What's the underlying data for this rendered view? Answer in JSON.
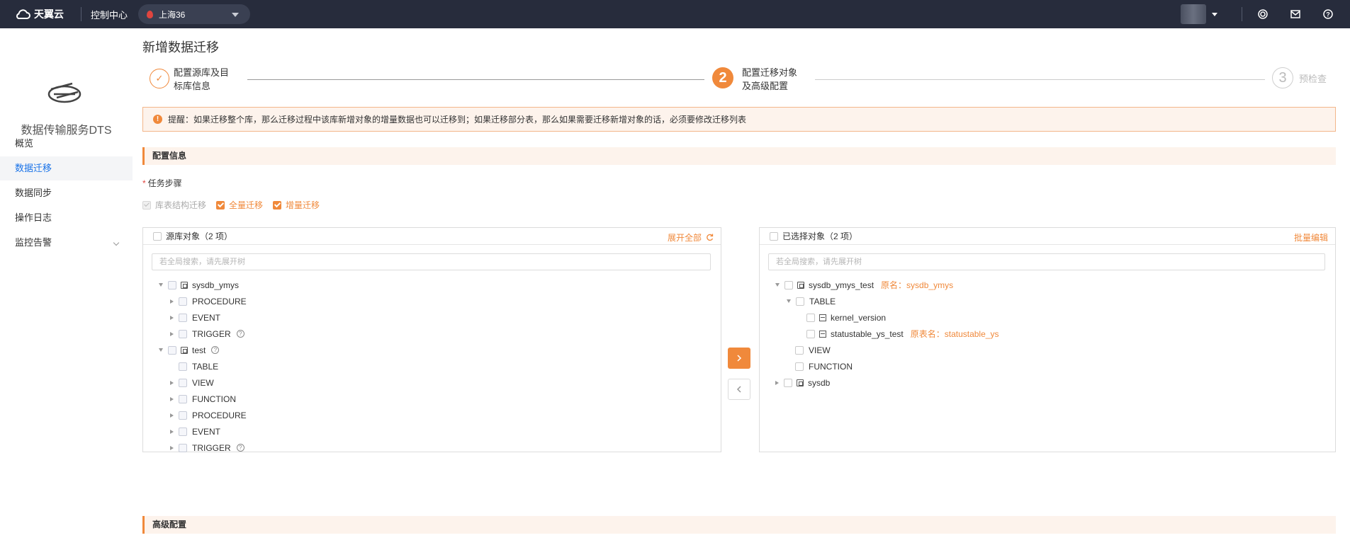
{
  "topbar": {
    "brand": "天翼云",
    "console": "控制中心",
    "region": "上海36",
    "icons": [
      "support-icon",
      "mail-icon",
      "help-icon"
    ]
  },
  "sidebar": {
    "title": "数据传输服务DTS",
    "items": [
      {
        "label": "概览",
        "active": false
      },
      {
        "label": "数据迁移",
        "active": true
      },
      {
        "label": "数据同步",
        "active": false
      },
      {
        "label": "操作日志",
        "active": false
      },
      {
        "label": "监控告警",
        "active": false,
        "expandable": true
      }
    ]
  },
  "main": {
    "title": "新增数据迁移",
    "steps": [
      {
        "label_line1": "配置源库及目",
        "label_line2": "标库信息",
        "state": "done",
        "number": "✓"
      },
      {
        "label_line1": "配置迁移对象",
        "label_line2": "及高级配置",
        "state": "active",
        "number": "2"
      },
      {
        "label_line1": "预检查",
        "label_line2": "",
        "state": "pending",
        "number": "3"
      }
    ],
    "notice": "提醒：如果迁移整个库，那么迁移过程中该库新增对象的增量数据也可以迁移到；如果迁移部分表，那么如果需要迁移新增对象的话，必须要修改迁移列表",
    "config_section": "配置信息",
    "task_steps_label": "任务步骤",
    "task_steps": [
      {
        "label": "库表结构迁移",
        "checked": true,
        "disabled": true
      },
      {
        "label": "全量迁移",
        "checked": true,
        "disabled": false
      },
      {
        "label": "增量迁移",
        "checked": true,
        "disabled": false
      }
    ],
    "advanced_section": "高级配置"
  },
  "source_panel": {
    "title": "源库对象（2 项）",
    "expand_all": "展开全部",
    "search_placeholder": "若全局搜索，请先展开树",
    "tree": [
      {
        "label": "sysdb_ymys",
        "level": 0,
        "toggle": "down",
        "icon": "database-icon"
      },
      {
        "label": "PROCEDURE",
        "level": 1,
        "toggle": "right"
      },
      {
        "label": "EVENT",
        "level": 1,
        "toggle": "right"
      },
      {
        "label": "TRIGGER",
        "level": 1,
        "toggle": "right",
        "help": true
      },
      {
        "label": "test",
        "level": 0,
        "toggle": "down",
        "icon": "database-icon",
        "help": true
      },
      {
        "label": "TABLE",
        "level": 1,
        "toggle": "none"
      },
      {
        "label": "VIEW",
        "level": 1,
        "toggle": "right"
      },
      {
        "label": "FUNCTION",
        "level": 1,
        "toggle": "right"
      },
      {
        "label": "PROCEDURE",
        "level": 1,
        "toggle": "right"
      },
      {
        "label": "EVENT",
        "level": 1,
        "toggle": "right"
      },
      {
        "label": "TRIGGER",
        "level": 1,
        "toggle": "right",
        "help": true
      }
    ]
  },
  "target_panel": {
    "title": "已选择对象（2 项）",
    "batch_edit": "批量编辑",
    "search_placeholder": "若全局搜索，请先展开树",
    "tree": [
      {
        "label": "sysdb_ymys_test",
        "level": 0,
        "toggle": "down",
        "icon": "database-icon",
        "orig": "原名：sysdb_ymys"
      },
      {
        "label": "TABLE",
        "level": 1,
        "toggle": "down"
      },
      {
        "label": "kernel_version",
        "level": 2,
        "toggle": "none",
        "icon": "table-icon"
      },
      {
        "label": "statustable_ys_test",
        "level": 2,
        "toggle": "none",
        "icon": "table-icon",
        "orig": "原表名：statustable_ys"
      },
      {
        "label": "VIEW",
        "level": 1,
        "toggle": "none"
      },
      {
        "label": "FUNCTION",
        "level": 1,
        "toggle": "none"
      },
      {
        "label": "sysdb",
        "level": 0,
        "toggle": "right",
        "icon": "database-icon"
      }
    ]
  },
  "colors": {
    "accent": "#f0893b",
    "topbar": "#272c3c",
    "link_blue": "#1a73e8"
  }
}
